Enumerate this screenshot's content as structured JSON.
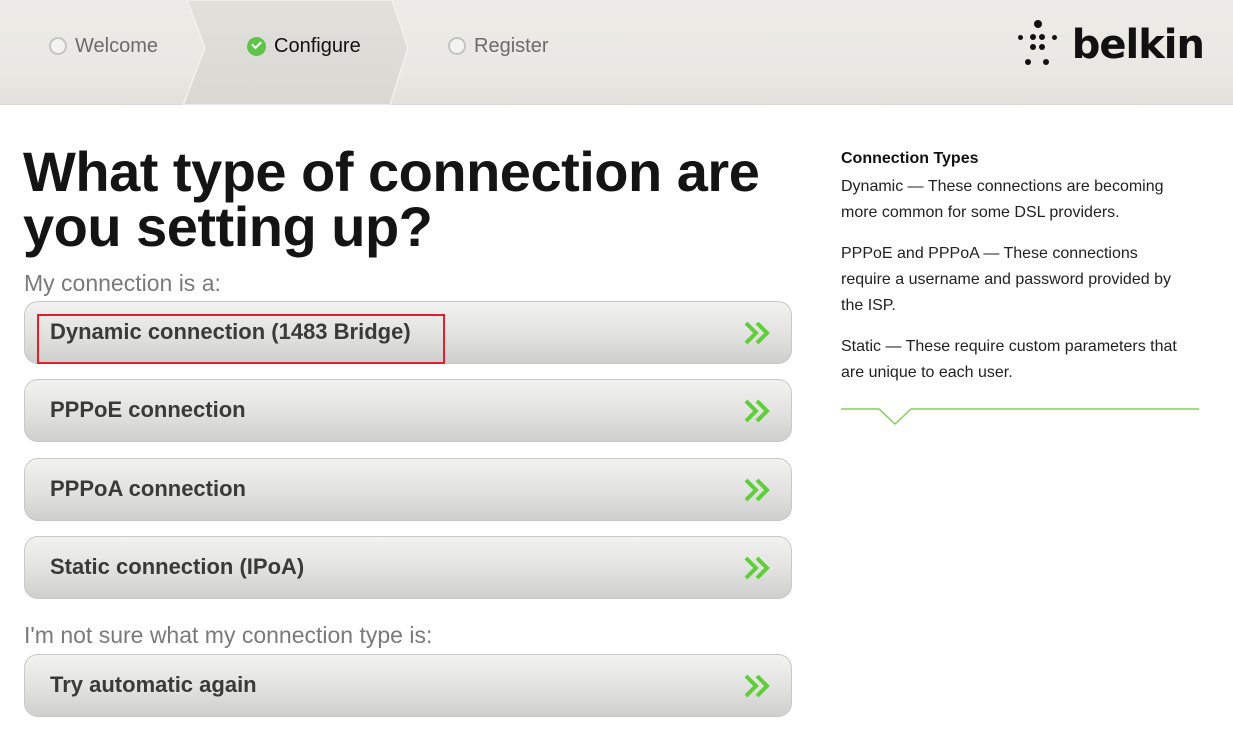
{
  "header": {
    "steps": [
      {
        "label": "Welcome",
        "state": "incomplete"
      },
      {
        "label": "Configure",
        "state": "active"
      },
      {
        "label": "Register",
        "state": "incomplete"
      }
    ],
    "logo_text": "belkin",
    "accent_color": "#5fc44a"
  },
  "main": {
    "title": "What type of connection are you setting up?",
    "connection_label": "My connection is a:",
    "connection_options": [
      {
        "label": "Dynamic connection (1483 Bridge)",
        "highlighted": true
      },
      {
        "label": "PPPoE connection"
      },
      {
        "label": "PPPoA connection"
      },
      {
        "label": "Static connection (IPoA)"
      }
    ],
    "unsure_label": "I'm not sure what my connection type is:",
    "auto_button_label": "Try automatic again",
    "arrow_icon": "double-chevron-right-icon"
  },
  "sidebar": {
    "title": "Connection Types",
    "paragraphs": [
      "Dynamic — These connections are becoming more common for some DSL providers.",
      "PPPoE and PPPoA — These connections require a username and password provided by the ISP.",
      "Static — These require custom parameters that are unique to each user."
    ]
  }
}
